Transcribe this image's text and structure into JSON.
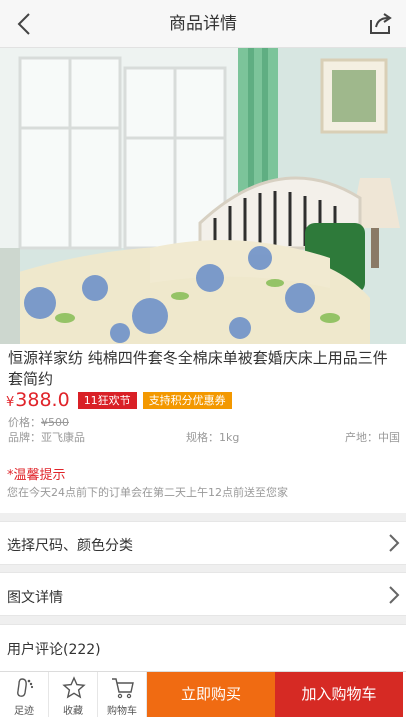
{
  "header": {
    "title": "商品详情",
    "back_icon": "chevron-left-icon",
    "share_icon": "share-icon"
  },
  "gallery": {
    "slide_count": 4,
    "active_index": 0
  },
  "product": {
    "title": "恒源祥家纺 纯棉四件套冬全棉床单被套婚庆床上用品三件套简约",
    "currency": "¥",
    "price": "388.0",
    "badge_festival": "11狂欢节",
    "badge_points": "支持积分优惠券",
    "original_price_label": "价格：",
    "original_price": "¥500",
    "brand": "品牌：亚飞康品",
    "spec": "规格：1kg",
    "origin": "产地：中国"
  },
  "notice": {
    "title": "*温馨提示",
    "text": "您在今天24点前下的订单会在第二天上午12点前送至您家"
  },
  "sections": {
    "size_color": "选择尺码、颜色分类",
    "detail": "图文详情",
    "reviews": "用户评论(222)"
  },
  "bottom_bar": {
    "footprint": "足迹",
    "favorite": "收藏",
    "cart_tool": "购物车",
    "buy_now": "立即购买",
    "add_cart": "加入购物车"
  },
  "colors": {
    "price_red": "#e0242a",
    "buy_orange": "#f06b12",
    "cart_red": "#d62a24"
  }
}
